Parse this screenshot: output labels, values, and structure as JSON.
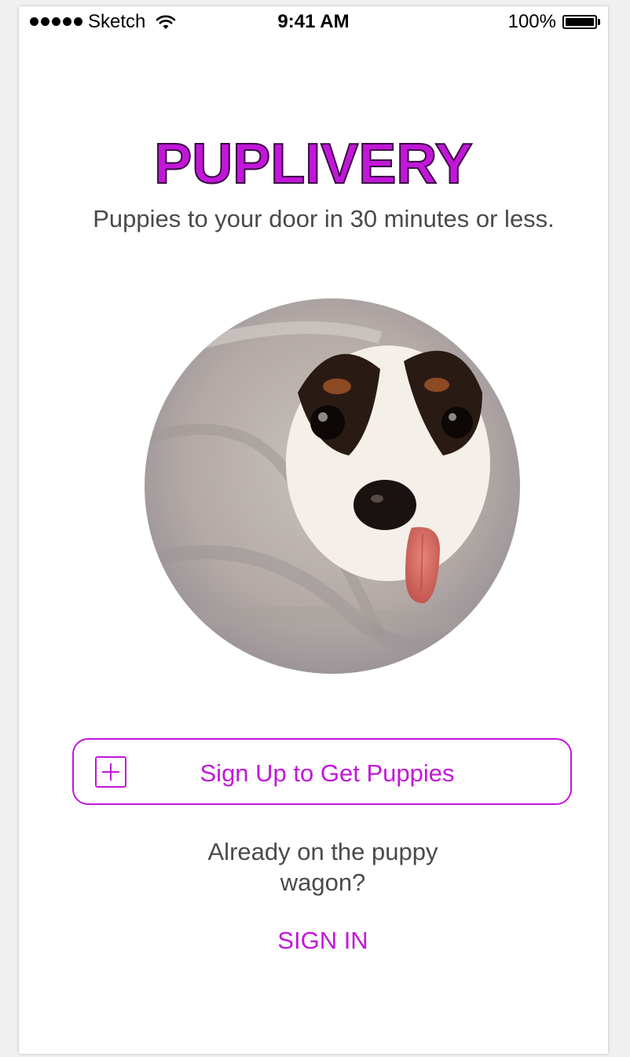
{
  "status_bar": {
    "carrier": "Sketch",
    "time": "9:41 AM",
    "battery": "100%",
    "icons": [
      "signal-dots-icon",
      "wifi-icon",
      "battery-icon"
    ]
  },
  "brand": {
    "title": "PUPLIVERY",
    "tagline": "Puppies to your door in 30 minutes or less."
  },
  "hero": {
    "image": "puppy-photo"
  },
  "signup": {
    "label": "Sign Up to Get Puppies",
    "icon": "plus-square-icon"
  },
  "signin": {
    "prompt": "Already on the puppy wagon?",
    "link": "SIGN IN"
  },
  "colors": {
    "accent": "#c217d9",
    "text": "#4a4a4a",
    "background": "#ffffff"
  }
}
